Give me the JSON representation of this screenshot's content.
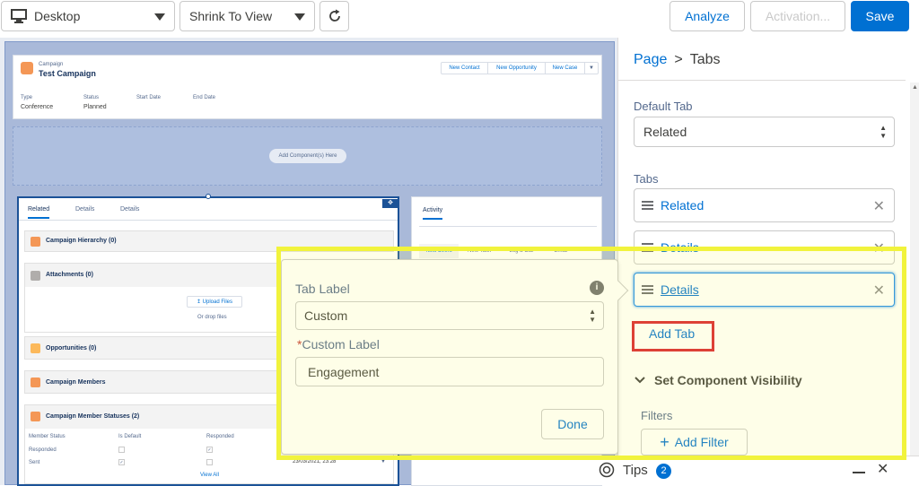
{
  "toolbar": {
    "device_select": "Desktop",
    "view_select": "Shrink To View",
    "analyze": "Analyze",
    "activation": "Activation...",
    "save": "Save"
  },
  "canvas": {
    "record_type": "Campaign",
    "record_name": "Test Campaign",
    "actions": [
      "New Contact",
      "New Opportunity",
      "New Case"
    ],
    "fields": [
      {
        "label": "Type",
        "value": "Conference"
      },
      {
        "label": "Status",
        "value": "Planned"
      },
      {
        "label": "Start Date",
        "value": ""
      },
      {
        "label": "End Date",
        "value": ""
      }
    ],
    "add_component": "Add Component(s) Here",
    "tabs": [
      "Related",
      "Details",
      "Details"
    ],
    "related_lists": [
      "Campaign Hierarchy (0)",
      "Attachments (0)",
      "Opportunities (0)",
      "Campaign Members",
      "Campaign Member Statuses (2)"
    ],
    "upload_files": "Upload Files",
    "or_drop_files": "Or drop files",
    "status_columns": [
      "Member Status",
      "Is Default",
      "Responded"
    ],
    "status_rows": [
      "Responded",
      "Sent"
    ],
    "sent_date": "23/03/2021, 23:28",
    "view_all": "View All",
    "activity_tab": "Activity",
    "activity_actions": [
      "New Event",
      "New Task",
      "Log a Call",
      "Email"
    ]
  },
  "panel": {
    "breadcrumb_page": "Page",
    "breadcrumb_sep": ">",
    "breadcrumb_current": "Tabs",
    "default_tab_label": "Default Tab",
    "default_tab_value": "Related",
    "tabs_label": "Tabs",
    "tabs": [
      "Related",
      "Details",
      "Details"
    ],
    "add_tab": "Add Tab",
    "visibility": "Set Component Visibility",
    "filters": "Filters",
    "add_filter": "Add Filter",
    "tips": "Tips",
    "tips_count": "2"
  },
  "popover": {
    "tab_label": "Tab Label",
    "tab_label_value": "Custom",
    "custom_label_required": "*",
    "custom_label": "Custom Label",
    "custom_label_value": "Engagement",
    "done": "Done"
  }
}
